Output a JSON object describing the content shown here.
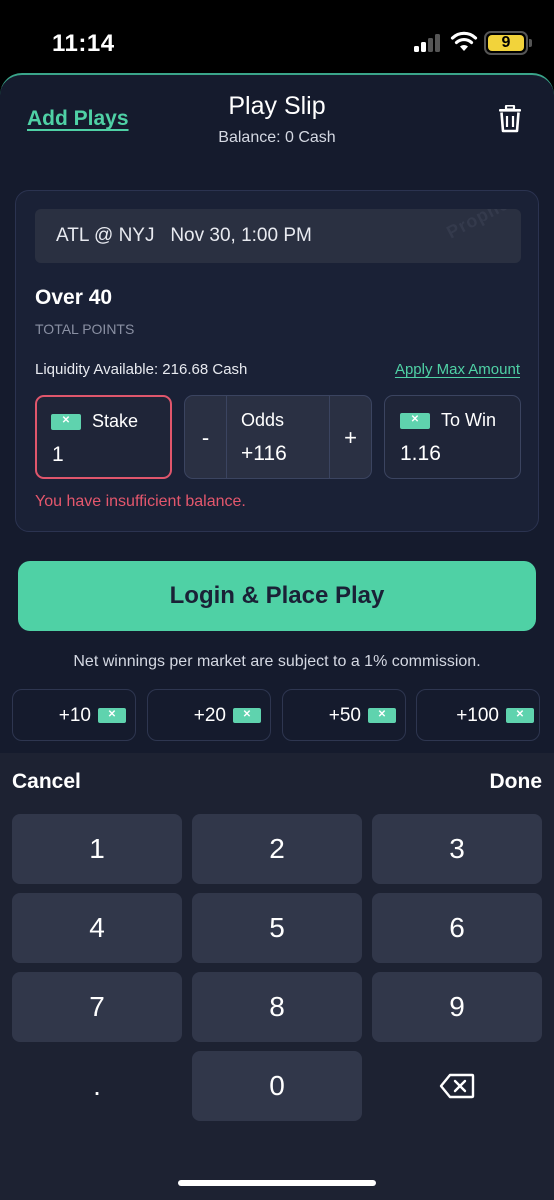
{
  "status": {
    "time": "11:14",
    "battery": "9"
  },
  "header": {
    "add_plays": "Add Plays",
    "title": "Play Slip",
    "balance": "Balance: 0 Cash"
  },
  "event": {
    "matchup": "ATL @ NYJ",
    "datetime": "Nov 30, 1:00 PM",
    "watermark": "ProphetX"
  },
  "market": {
    "line": "Over 40",
    "type": "TOTAL POINTS"
  },
  "liquidity": {
    "text": "Liquidity Available: 216.68 Cash",
    "apply_max": "Apply Max Amount"
  },
  "stake": {
    "label": "Stake",
    "value": "1"
  },
  "odds": {
    "label": "Odds",
    "value": "+116",
    "minus": "-",
    "plus": "+"
  },
  "to_win": {
    "label": "To Win",
    "value": "1.16"
  },
  "error": "You have insufficient balance.",
  "cta": "Login & Place Play",
  "commission": "Net winnings per market are subject to a 1% commission.",
  "quick_amounts": [
    "+10",
    "+20",
    "+50",
    "+100"
  ],
  "keyboard": {
    "cancel": "Cancel",
    "done": "Done",
    "keys": [
      "1",
      "2",
      "3",
      "4",
      "5",
      "6",
      "7",
      "8",
      "9",
      ".",
      "0"
    ]
  },
  "colors": {
    "accent": "#4fd1a5",
    "error": "#e4576d",
    "background": "#151b2d"
  },
  "icons": {
    "trash": "trash-icon",
    "backspace": "backspace-icon",
    "cash": "cash-icon"
  }
}
